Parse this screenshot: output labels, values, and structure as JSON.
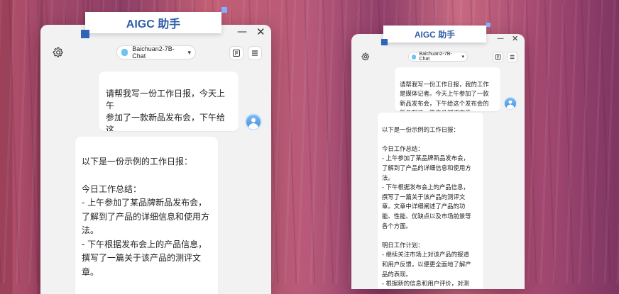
{
  "app": {
    "title": "AIGC 助手",
    "model": "Baichuan2-7B-Chat",
    "accent": "#2f5ea8",
    "minimize_glyph": "—",
    "close_glyph": "✕"
  },
  "icons": {
    "settings": "gear-icon",
    "attach": "document-icon",
    "menu": "hamburger-icon",
    "user": "user-avatar-icon"
  },
  "left_chat": {
    "user_message": "请帮我写一份工作日报，今天上午\n参加了一款新品发布会，下午给这\n个发布会的新品写了一篇产品测评\n文章。",
    "reply": "以下是一份示例的工作日报：\n\n今日工作总结：\n- 上午参加了某品牌新品发布会，\n了解到了产品的详细信息和使用方\n法。\n- 下午根据发布会上的产品信息，\n撰写了一篇关于该产品的测评文\n章。\n\n明日工作计划："
  },
  "right_chat": {
    "user_message": "请帮我写一份工作日报，我的工作\n是媒体记者。今天上午参加了一款\n新品发布会，下午给这个发布会的\n新品写了一篇产品测评文章。",
    "reply": "以下是一份示例的工作日报：\n\n今日工作总结：\n- 上午参加了某品牌新品发布会，\n了解到了产品的详细信息和使用方\n法。\n- 下午根据发布会上的产品信息，\n撰写了一篇关于该产品的测评文\n章。文章中详细阐述了产品的功\n能、性能、优缺点以及市场前景等\n各个方面。\n\n明日工作计划：\n- 继续关注市场上对该产品的报道\n和用户反馈，以便更全面地了解产\n品的表现。\n- 根据新的信息和用户评价，对测"
  }
}
